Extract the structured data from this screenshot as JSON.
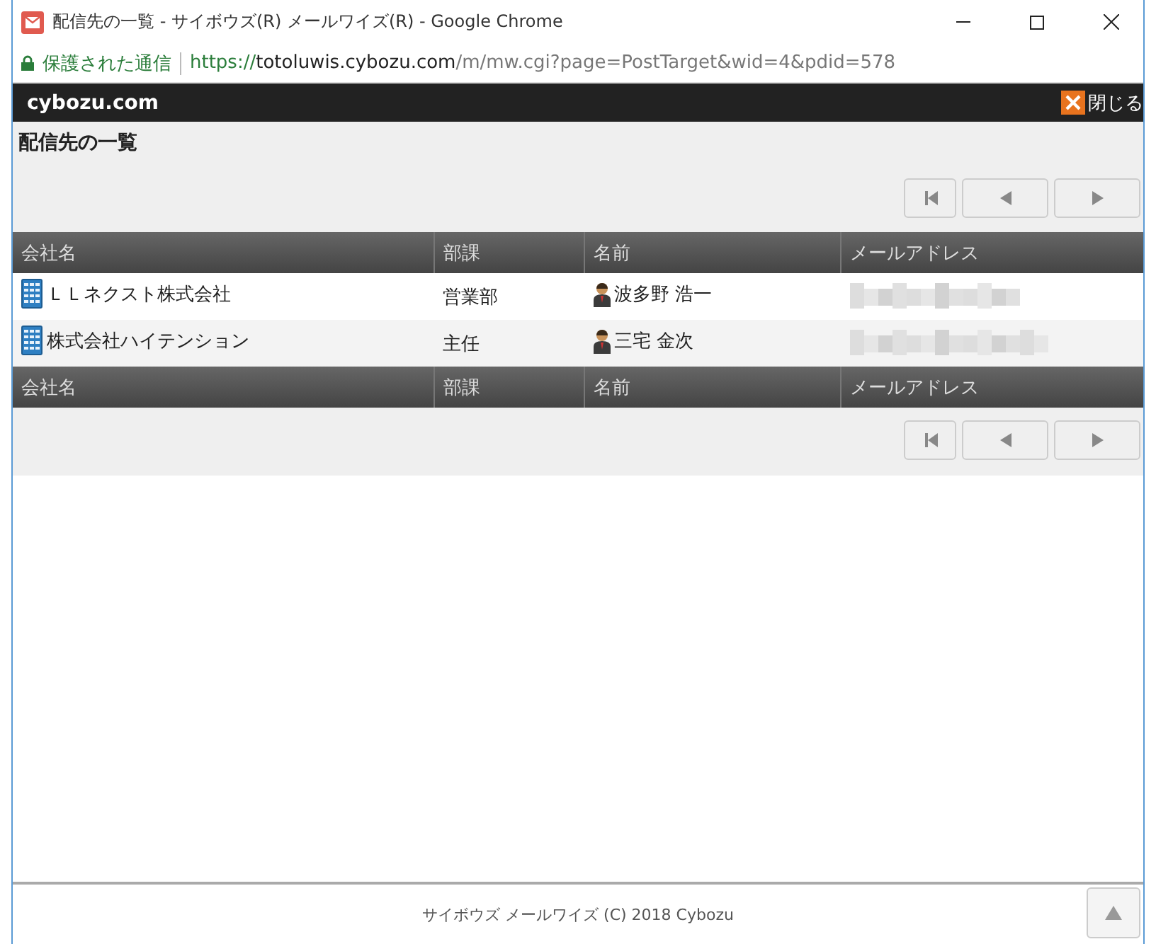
{
  "window": {
    "title": "配信先の一覧 - サイボウズ(R) メールワイズ(R) - Google Chrome"
  },
  "address_bar": {
    "security_label": "保護された通信",
    "url_scheme": "https://",
    "url_host": "totoluwis.cybozu.com",
    "url_path": "/m/mw.cgi?page=PostTarget&wid=4&pdid=578"
  },
  "header": {
    "logo": "cybozu.com",
    "close_label": "閉じる"
  },
  "page_title": "配信先の一覧",
  "pager_buttons": [
    {
      "kind": "first"
    },
    {
      "kind": "prev"
    },
    {
      "kind": "next"
    }
  ],
  "table": {
    "columns": [
      "会社名",
      "部課",
      "名前",
      "メールアドレス"
    ],
    "rows": [
      {
        "company": "ＬＬネクスト株式会社",
        "department": "営業部",
        "name": "波多野 浩一",
        "email_hidden": true
      },
      {
        "company": "株式会社ハイテンション",
        "department": "主任",
        "name": "三宅 金次",
        "email_hidden": true
      }
    ],
    "footer_columns": [
      "会社名",
      "部課",
      "名前",
      "メールアドレス"
    ]
  },
  "footer": {
    "copyright": "サイボウズ メールワイズ (C) 2018 Cybozu"
  }
}
